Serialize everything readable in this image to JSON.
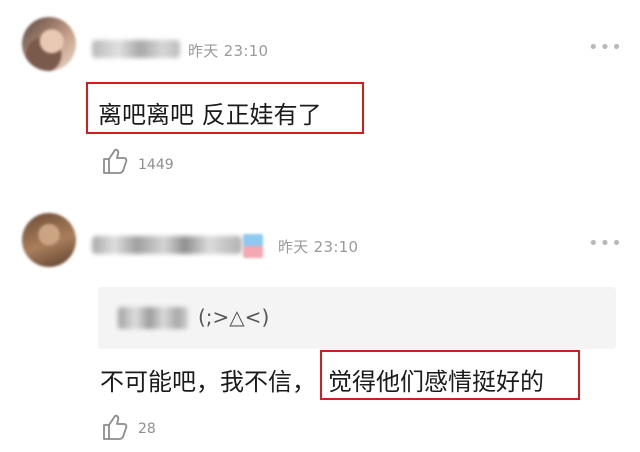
{
  "comments": [
    {
      "time_label": "昨天 23:10",
      "text": "离吧离吧  反正娃有了",
      "like_count": "1449"
    },
    {
      "time_label": "昨天 23:10",
      "quote": {
        "text": "(;>△<)"
      },
      "text_plain": "不可能吧，我不信，",
      "text_highlighted": "觉得他们感情挺好的",
      "like_count": "28"
    }
  ],
  "more_label": "•••",
  "highlight_color": "#d11d1d",
  "icons": {
    "like": "thumbs-up-icon",
    "more": "more-dots-icon"
  }
}
